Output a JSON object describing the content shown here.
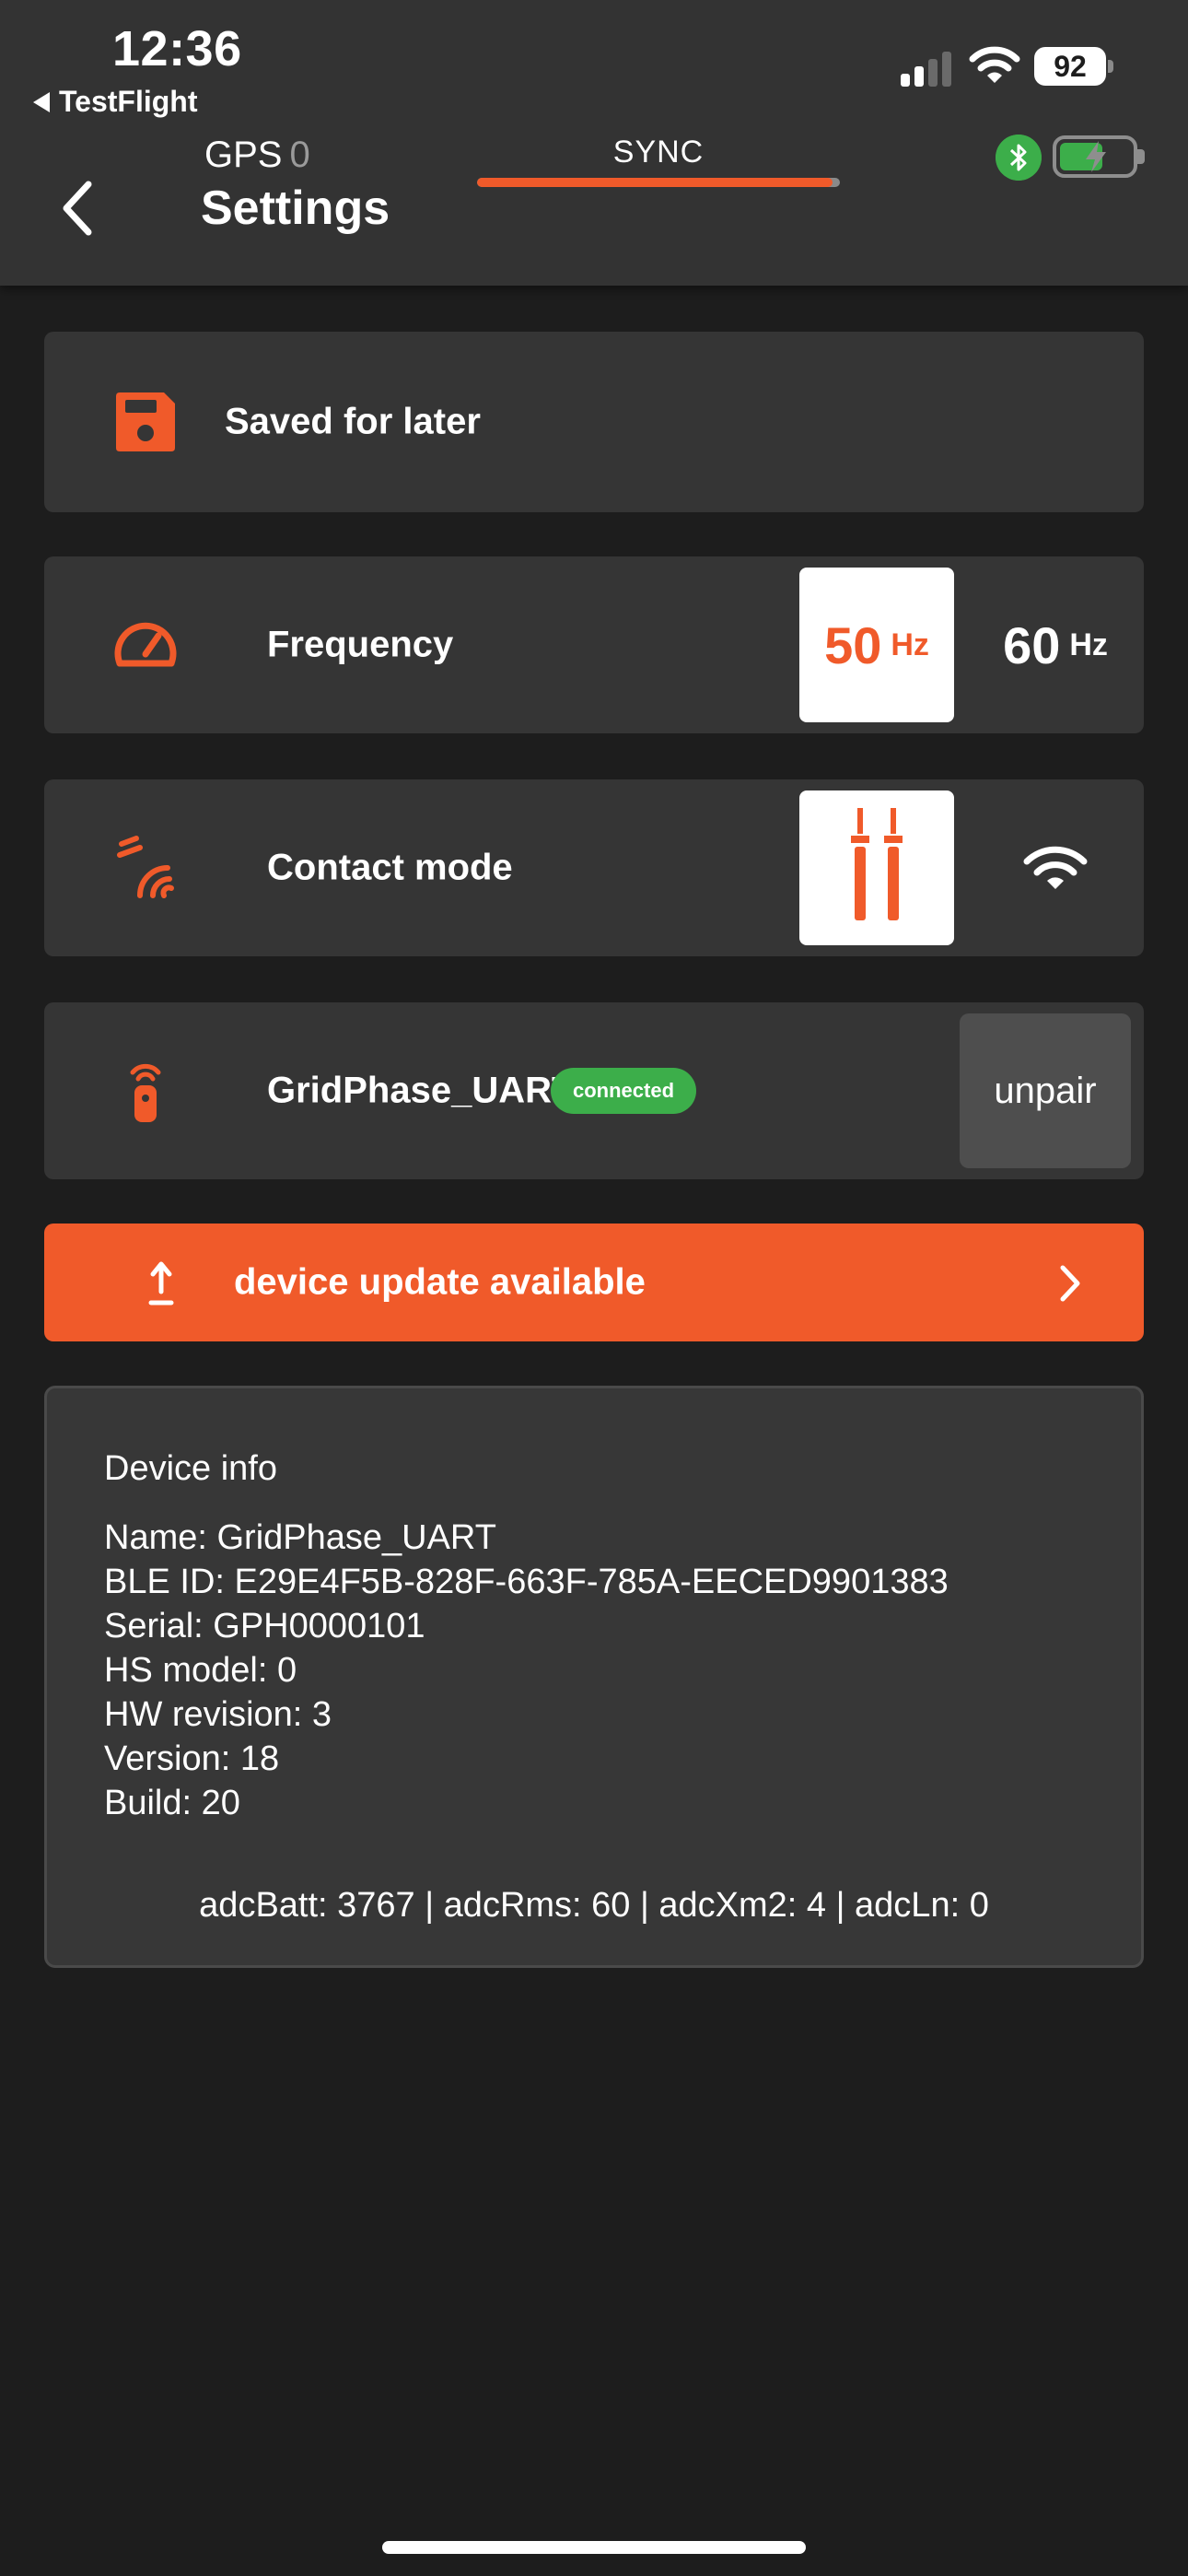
{
  "status_bar": {
    "time": "12:36",
    "back_app": "TestFlight",
    "battery_percent": "92",
    "signal_bars_active": 2,
    "signal_bars_total": 4
  },
  "header": {
    "gps_label": "GPS",
    "gps_value": "0",
    "sync_label": "SYNC",
    "sync_progress_percent": 98,
    "title": "Settings",
    "device_battery_level_percent": 60,
    "colors": {
      "accent": "#f05a2a",
      "ok": "#3cae4a",
      "background": "#1d1d1d",
      "card": "#353535"
    }
  },
  "saved": {
    "icon": "floppy-disk-icon",
    "label": "Saved for later"
  },
  "frequency": {
    "icon": "gauge-icon",
    "label": "Frequency",
    "options": [
      {
        "value": "50",
        "unit": "Hz",
        "selected": true
      },
      {
        "value": "60",
        "unit": "Hz",
        "selected": false
      }
    ]
  },
  "contact_mode": {
    "icon": "contact-waves-icon",
    "label": "Contact mode",
    "options": [
      {
        "icon": "probes-icon",
        "selected": true
      },
      {
        "icon": "wireless-icon",
        "selected": false
      }
    ]
  },
  "device": {
    "icon": "remote-sensor-icon",
    "name": "GridPhase_UART",
    "status": "connected",
    "unpair_label": "unpair"
  },
  "update": {
    "icon": "upload-arrow-icon",
    "label": "device update available",
    "chevron": "chevron-right-icon"
  },
  "device_info": {
    "title": "Device info",
    "lines": [
      "Name: GridPhase_UART",
      "BLE ID: E29E4F5B-828F-663F-785A-EECED9901383",
      "Serial: GPH0000101",
      "HS model: 0",
      "HW revision: 3",
      "Version: 18",
      "Build: 20"
    ],
    "adc": "adcBatt: 3767 | adcRms: 60 | adcXm2: 4 | adcLn: 0"
  }
}
